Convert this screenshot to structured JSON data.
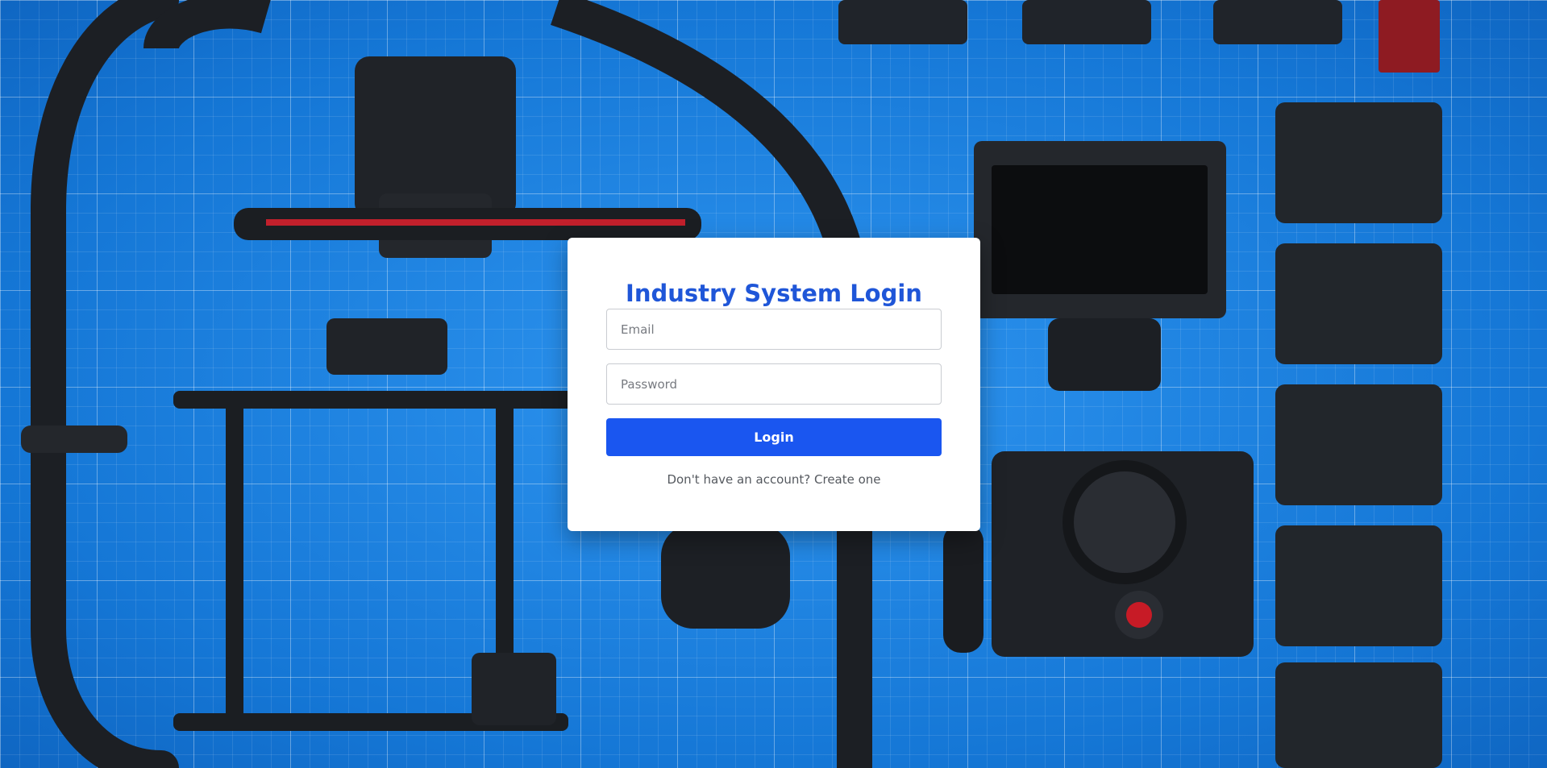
{
  "login": {
    "title": "Industry System Login",
    "email_placeholder": "Email",
    "password_placeholder": "Password",
    "submit_label": "Login",
    "signup_prompt": "Don't have an account?",
    "signup_link": "Create one"
  },
  "colors": {
    "accent": "#1a56f0",
    "title": "#1f56d8",
    "background": "#1a82e0"
  }
}
